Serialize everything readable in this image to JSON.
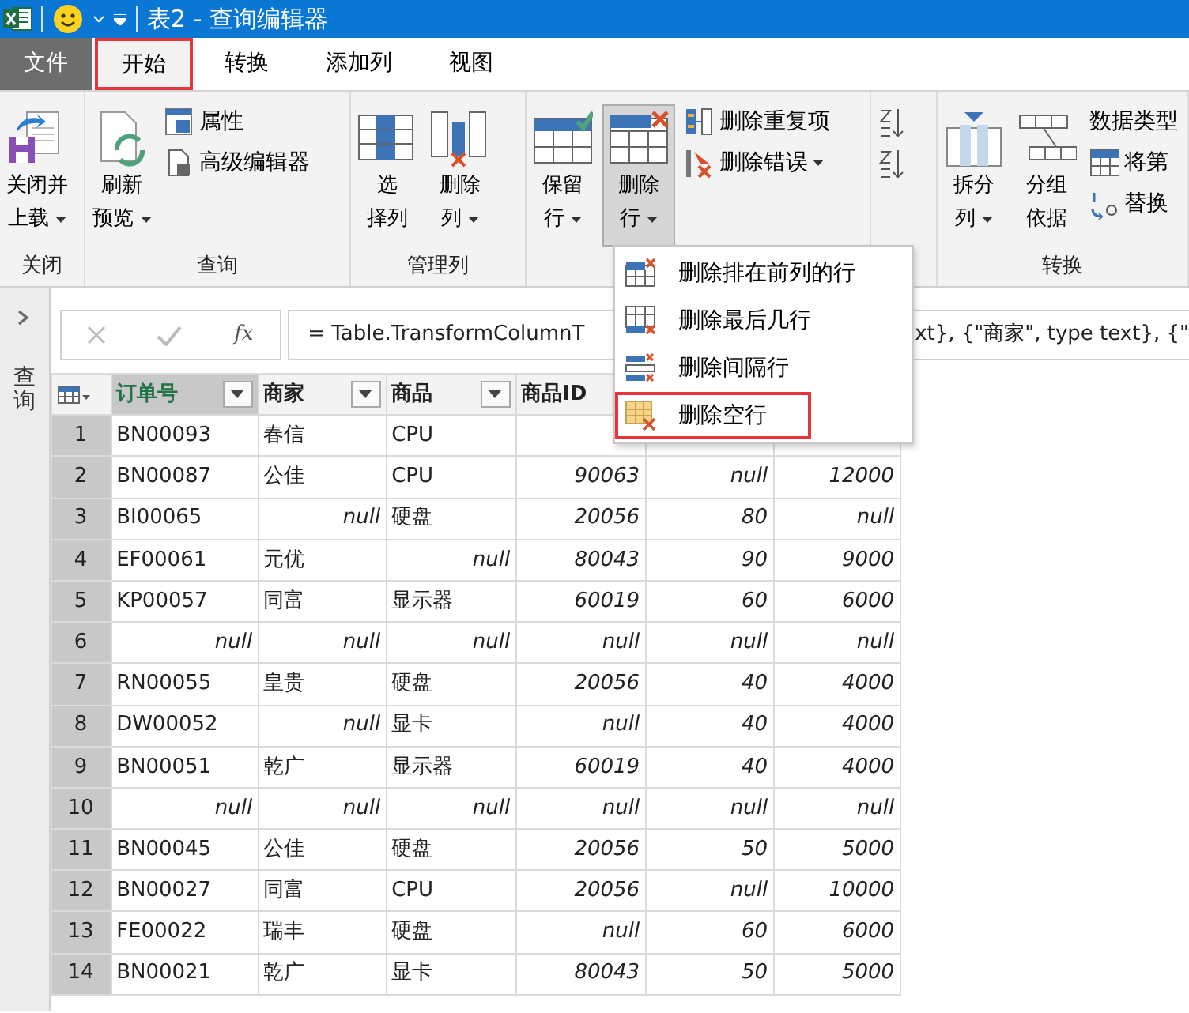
{
  "title_bar": {
    "title": "表2 - 查询编辑器"
  },
  "menu_tabs": [
    {
      "label": "文件",
      "kind": "file",
      "selected": false,
      "highlighted": false
    },
    {
      "label": "开始",
      "kind": "tab",
      "selected": true,
      "highlighted": true
    },
    {
      "label": "转换",
      "kind": "tab",
      "selected": false,
      "highlighted": false
    },
    {
      "label": "添加列",
      "kind": "tab",
      "selected": false,
      "highlighted": false
    },
    {
      "label": "视图",
      "kind": "tab",
      "selected": false,
      "highlighted": false
    }
  ],
  "ribbon": {
    "groups": [
      {
        "label": "关闭",
        "large_buttons": [
          {
            "lines": [
              "关闭并",
              "上载"
            ],
            "dropdown": true,
            "pressed": false
          }
        ]
      },
      {
        "label": "查询",
        "large_buttons": [
          {
            "lines": [
              "刷新",
              "预览"
            ],
            "dropdown": true,
            "pressed": false
          }
        ],
        "small_buttons": [
          {
            "label": "属性",
            "dropdown": false
          },
          {
            "label": "高级编辑器",
            "dropdown": false
          }
        ]
      },
      {
        "label": "管理列",
        "large_buttons": [
          {
            "lines": [
              "选",
              "择列"
            ],
            "dropdown": false,
            "pressed": false
          },
          {
            "lines": [
              "删除",
              "列"
            ],
            "dropdown": true,
            "pressed": false
          }
        ]
      },
      {
        "large_buttons": [
          {
            "lines": [
              "保留",
              "行"
            ],
            "dropdown": true,
            "pressed": false
          },
          {
            "lines": [
              "删除",
              "行"
            ],
            "dropdown": true,
            "pressed": true
          }
        ],
        "small_buttons": [
          {
            "label": "删除重复项",
            "dropdown": false
          },
          {
            "label": "删除错误",
            "dropdown": true
          }
        ]
      },
      {
        "small_buttons": [
          {
            "dropdown": false
          },
          {
            "dropdown": false
          }
        ]
      },
      {
        "label": "转换",
        "large_buttons": [
          {
            "lines": [
              "拆分",
              "列"
            ],
            "dropdown": true,
            "pressed": false
          },
          {
            "lines": [
              "分组",
              "依据"
            ],
            "dropdown": false,
            "pressed": false
          }
        ],
        "small_buttons": [
          {
            "label": "数据类型",
            "dropdown": false
          },
          {
            "label": "将第",
            "dropdown": false
          },
          {
            "label": "替换",
            "dropdown": false
          }
        ]
      }
    ]
  },
  "queries_pane": {
    "label": "查询"
  },
  "formula_bar": {
    "fx": "fx",
    "formula_left": "= Table.TransformColumnT",
    "formula_right": "xt}, {\"商家\", type text}, {\""
  },
  "table": {
    "columns": [
      {
        "label": "订单号",
        "selected": true
      },
      {
        "label": "商家",
        "selected": false
      },
      {
        "label": "商品",
        "selected": false
      },
      {
        "label": "商品ID",
        "selected": false
      }
    ],
    "rows": [
      {
        "number": "1",
        "cells": [
          {
            "text": "BN00093",
            "kind": "text"
          },
          {
            "text": "春信",
            "kind": "text"
          },
          {
            "text": "CPU",
            "kind": "text"
          }
        ]
      },
      {
        "number": "2",
        "cells": [
          {
            "text": "BN00087",
            "kind": "text"
          },
          {
            "text": "公佳",
            "kind": "text"
          },
          {
            "text": "CPU",
            "kind": "text"
          },
          {
            "text": "90063",
            "kind": "number"
          },
          {
            "text": "null",
            "kind": "null"
          },
          {
            "text": "12000",
            "kind": "number"
          }
        ]
      },
      {
        "number": "3",
        "cells": [
          {
            "text": "BI00065",
            "kind": "text"
          },
          {
            "text": "null",
            "kind": "null"
          },
          {
            "text": "硬盘",
            "kind": "text"
          },
          {
            "text": "20056",
            "kind": "number"
          },
          {
            "text": "80",
            "kind": "number"
          },
          {
            "text": "null",
            "kind": "null"
          }
        ]
      },
      {
        "number": "4",
        "cells": [
          {
            "text": "EF00061",
            "kind": "text"
          },
          {
            "text": "元优",
            "kind": "text"
          },
          {
            "text": "null",
            "kind": "null"
          },
          {
            "text": "80043",
            "kind": "number"
          },
          {
            "text": "90",
            "kind": "number"
          },
          {
            "text": "9000",
            "kind": "number"
          }
        ]
      },
      {
        "number": "5",
        "cells": [
          {
            "text": "KP00057",
            "kind": "text"
          },
          {
            "text": "同富",
            "kind": "text"
          },
          {
            "text": "显示器",
            "kind": "text"
          },
          {
            "text": "60019",
            "kind": "number"
          },
          {
            "text": "60",
            "kind": "number"
          },
          {
            "text": "6000",
            "kind": "number"
          }
        ]
      },
      {
        "number": "6",
        "cells": [
          {
            "text": "null",
            "kind": "null"
          },
          {
            "text": "null",
            "kind": "null"
          },
          {
            "text": "null",
            "kind": "null"
          },
          {
            "text": "null",
            "kind": "null"
          },
          {
            "text": "null",
            "kind": "null"
          },
          {
            "text": "null",
            "kind": "null"
          }
        ]
      },
      {
        "number": "7",
        "cells": [
          {
            "text": "RN00055",
            "kind": "text"
          },
          {
            "text": "皇贵",
            "kind": "text"
          },
          {
            "text": "硬盘",
            "kind": "text"
          },
          {
            "text": "20056",
            "kind": "number"
          },
          {
            "text": "40",
            "kind": "number"
          },
          {
            "text": "4000",
            "kind": "number"
          }
        ]
      },
      {
        "number": "8",
        "cells": [
          {
            "text": "DW00052",
            "kind": "text"
          },
          {
            "text": "null",
            "kind": "null"
          },
          {
            "text": "显卡",
            "kind": "text"
          },
          {
            "text": "null",
            "kind": "null"
          },
          {
            "text": "40",
            "kind": "number"
          },
          {
            "text": "4000",
            "kind": "number"
          }
        ]
      },
      {
        "number": "9",
        "cells": [
          {
            "text": "BN00051",
            "kind": "text"
          },
          {
            "text": "乾广",
            "kind": "text"
          },
          {
            "text": "显示器",
            "kind": "text"
          },
          {
            "text": "60019",
            "kind": "number"
          },
          {
            "text": "40",
            "kind": "number"
          },
          {
            "text": "4000",
            "kind": "number"
          }
        ]
      },
      {
        "number": "10",
        "cells": [
          {
            "text": "null",
            "kind": "null"
          },
          {
            "text": "null",
            "kind": "null"
          },
          {
            "text": "null",
            "kind": "null"
          },
          {
            "text": "null",
            "kind": "null"
          },
          {
            "text": "null",
            "kind": "null"
          },
          {
            "text": "null",
            "kind": "null"
          }
        ]
      },
      {
        "number": "11",
        "cells": [
          {
            "text": "BN00045",
            "kind": "text"
          },
          {
            "text": "公佳",
            "kind": "text"
          },
          {
            "text": "硬盘",
            "kind": "text"
          },
          {
            "text": "20056",
            "kind": "number"
          },
          {
            "text": "50",
            "kind": "number"
          },
          {
            "text": "5000",
            "kind": "number"
          }
        ]
      },
      {
        "number": "12",
        "cells": [
          {
            "text": "BN00027",
            "kind": "text"
          },
          {
            "text": "同富",
            "kind": "text"
          },
          {
            "text": "CPU",
            "kind": "text"
          },
          {
            "text": "20056",
            "kind": "number"
          },
          {
            "text": "null",
            "kind": "null"
          },
          {
            "text": "10000",
            "kind": "number"
          }
        ]
      },
      {
        "number": "13",
        "cells": [
          {
            "text": "FE00022",
            "kind": "text"
          },
          {
            "text": "瑞丰",
            "kind": "text"
          },
          {
            "text": "硬盘",
            "kind": "text"
          },
          {
            "text": "null",
            "kind": "null"
          },
          {
            "text": "60",
            "kind": "number"
          },
          {
            "text": "6000",
            "kind": "number"
          }
        ]
      },
      {
        "number": "14",
        "cells": [
          {
            "text": "BN00021",
            "kind": "text"
          },
          {
            "text": "乾广",
            "kind": "text"
          },
          {
            "text": "显卡",
            "kind": "text"
          },
          {
            "text": "80043",
            "kind": "number"
          },
          {
            "text": "50",
            "kind": "number"
          },
          {
            "text": "5000",
            "kind": "number"
          }
        ]
      }
    ]
  },
  "dropdown_menu": {
    "items": [
      {
        "label": "删除排在前列的行",
        "kind": "remove-top",
        "highlighted": false
      },
      {
        "label": "删除最后几行",
        "kind": "remove-bottom",
        "highlighted": false
      },
      {
        "label": "删除间隔行",
        "kind": "remove-alternate",
        "highlighted": false
      },
      {
        "label": "删除空行",
        "kind": "remove-blank",
        "highlighted": true
      }
    ]
  }
}
